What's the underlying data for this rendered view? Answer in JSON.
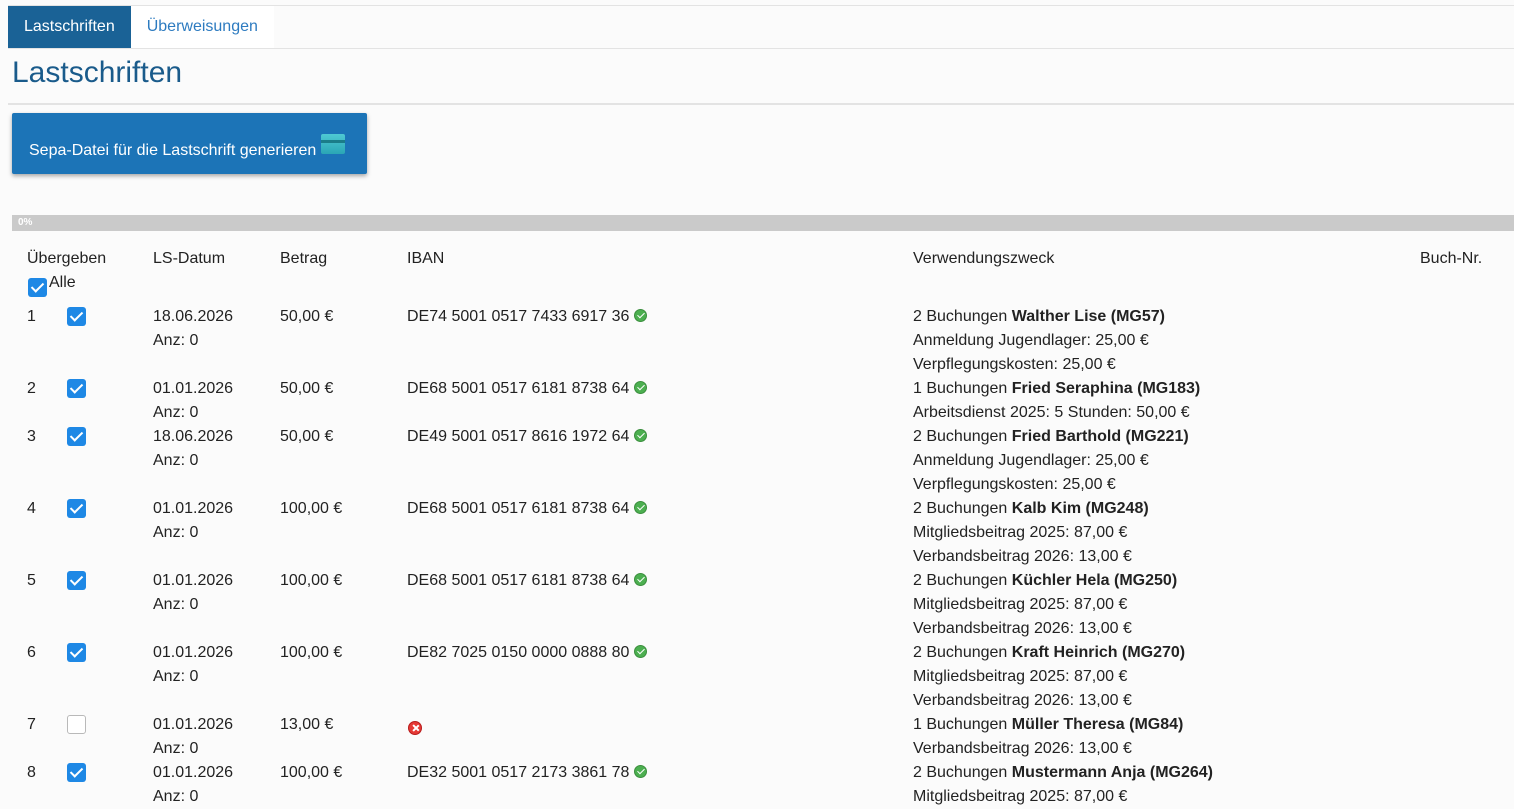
{
  "tabs": [
    {
      "label": "Lastschriften",
      "active": true
    },
    {
      "label": "Überweisungen",
      "active": false
    }
  ],
  "page_title": "Lastschriften",
  "sepa_button": {
    "label": "Sepa-Datei für die Lastschrift generieren",
    "icon": "credit-card-icon"
  },
  "progress": {
    "label": "0%",
    "value": 0
  },
  "columns": [
    "Übergeben",
    "LS-Datum",
    "Betrag",
    "IBAN",
    "Verwendungszweck",
    "Buch-Nr."
  ],
  "select_all": {
    "label": "Alle",
    "checked": true
  },
  "colors": {
    "accent": "#1a6296",
    "button": "#1c74b7",
    "checkbox": "#1e88e5",
    "ok": "#4caf50",
    "error": "#e53935"
  },
  "rows": [
    {
      "nr": "1",
      "checked": true,
      "date": "18.06.2026",
      "anz": "Anz: 0",
      "amount": "50,00 €",
      "iban": "DE74 5001 0517 7433 6917 36",
      "iban_status": "ok",
      "purpose_count": "2 Buchungen",
      "purpose_name": "Walther Lise (MG57)",
      "lines": [
        "Anmeldung Jugendlager: 25,00 €",
        "Verpflegungskosten: 25,00 €"
      ]
    },
    {
      "nr": "2",
      "checked": true,
      "date": "01.01.2026",
      "anz": "Anz: 0",
      "amount": "50,00 €",
      "iban": "DE68 5001 0517 6181 8738 64",
      "iban_status": "ok",
      "purpose_count": "1 Buchungen",
      "purpose_name": "Fried Seraphina (MG183)",
      "lines": [
        "Arbeitsdienst 2025: 5 Stunden: 50,00 €"
      ]
    },
    {
      "nr": "3",
      "checked": true,
      "date": "18.06.2026",
      "anz": "Anz: 0",
      "amount": "50,00 €",
      "iban": "DE49 5001 0517 8616 1972 64",
      "iban_status": "ok",
      "purpose_count": "2 Buchungen",
      "purpose_name": "Fried Barthold (MG221)",
      "lines": [
        "Anmeldung Jugendlager: 25,00 €",
        "Verpflegungskosten: 25,00 €"
      ]
    },
    {
      "nr": "4",
      "checked": true,
      "date": "01.01.2026",
      "anz": "Anz: 0",
      "amount": "100,00 €",
      "iban": "DE68 5001 0517 6181 8738 64",
      "iban_status": "ok",
      "purpose_count": "2 Buchungen",
      "purpose_name": "Kalb Kim (MG248)",
      "lines": [
        "Mitgliedsbeitrag 2025: 87,00 €",
        "Verbandsbeitrag 2026: 13,00 €"
      ]
    },
    {
      "nr": "5",
      "checked": true,
      "date": "01.01.2026",
      "anz": "Anz: 0",
      "amount": "100,00 €",
      "iban": "DE68 5001 0517 6181 8738 64",
      "iban_status": "ok",
      "purpose_count": "2 Buchungen",
      "purpose_name": "Küchler Hela (MG250)",
      "lines": [
        "Mitgliedsbeitrag 2025: 87,00 €",
        "Verbandsbeitrag 2026: 13,00 €"
      ]
    },
    {
      "nr": "6",
      "checked": true,
      "date": "01.01.2026",
      "anz": "Anz: 0",
      "amount": "100,00 €",
      "iban": "DE82 7025 0150 0000 0888 80",
      "iban_status": "ok",
      "purpose_count": "2 Buchungen",
      "purpose_name": "Kraft Heinrich (MG270)",
      "lines": [
        "Mitgliedsbeitrag 2025: 87,00 €",
        "Verbandsbeitrag 2026: 13,00 €"
      ]
    },
    {
      "nr": "7",
      "checked": false,
      "date": "01.01.2026",
      "anz": "Anz: 0",
      "amount": "13,00 €",
      "iban": "",
      "iban_status": "error",
      "purpose_count": "1 Buchungen",
      "purpose_name": "Müller Theresa (MG84)",
      "lines": [
        "Verbandsbeitrag 2026: 13,00 €"
      ]
    },
    {
      "nr": "8",
      "checked": true,
      "date": "01.01.2026",
      "anz": "Anz: 0",
      "amount": "100,00 €",
      "iban": "DE32 5001 0517 2173 3861 78",
      "iban_status": "ok",
      "purpose_count": "2 Buchungen",
      "purpose_name": "Mustermann Anja (MG264)",
      "lines": [
        "Mitgliedsbeitrag 2025: 87,00 €"
      ]
    }
  ]
}
